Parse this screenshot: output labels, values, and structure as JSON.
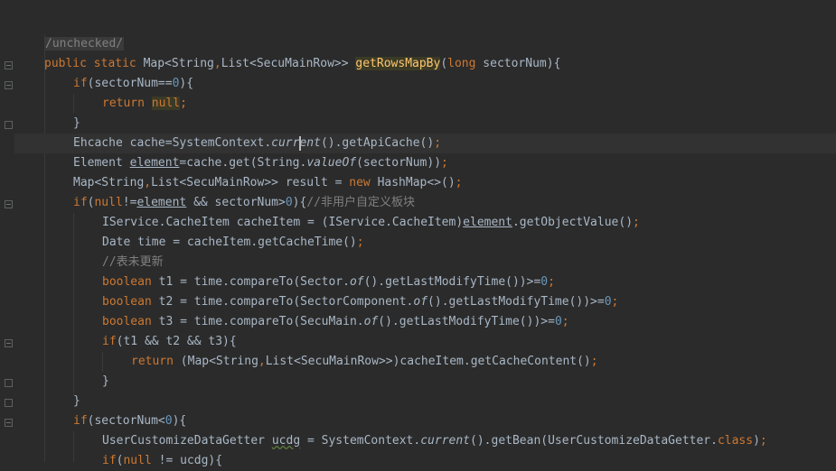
{
  "editor": {
    "lines": [
      {
        "tokens": [
          {
            "t": "/unchecked/",
            "c": "anno"
          }
        ]
      },
      {
        "tokens": [
          {
            "t": "public static ",
            "c": "kw"
          },
          {
            "t": "Map<String"
          },
          {
            "t": ",",
            "c": "kw"
          },
          {
            "t": "List<SecuMainRow>> "
          },
          {
            "t": "getRowsMapBy",
            "c": "fn-decl"
          },
          {
            "t": "("
          },
          {
            "t": "long ",
            "c": "kw"
          },
          {
            "t": "sectorNum){"
          }
        ]
      },
      {
        "tokens": [
          {
            "t": "if",
            "c": "kw"
          },
          {
            "t": "(sectorNum=="
          },
          {
            "t": "0",
            "c": "num"
          },
          {
            "t": "){"
          }
        ]
      },
      {
        "tokens": [
          {
            "t": "return ",
            "c": "kw"
          },
          {
            "t": "null",
            "c": "kw hl"
          },
          {
            "t": ";",
            "c": "kw"
          }
        ]
      },
      {
        "tokens": [
          {
            "t": "}"
          }
        ]
      },
      {
        "tokens": [
          {
            "t": "Ehcache cache=SystemContext."
          },
          {
            "t": "current",
            "c": "it"
          },
          {
            "t": "().getApiCache()"
          },
          {
            "t": ";",
            "c": "kw"
          }
        ]
      },
      {
        "tokens": [
          {
            "t": "Element "
          },
          {
            "t": "element",
            "c": "u"
          },
          {
            "t": "=cache.get(String."
          },
          {
            "t": "valueOf",
            "c": "it"
          },
          {
            "t": "(sectorNum))"
          },
          {
            "t": ";",
            "c": "kw"
          }
        ]
      },
      {
        "tokens": [
          {
            "t": "Map<String"
          },
          {
            "t": ",",
            "c": "kw"
          },
          {
            "t": "List<SecuMainRow>> result = "
          },
          {
            "t": "new ",
            "c": "kw"
          },
          {
            "t": "HashMap<>()"
          },
          {
            "t": ";",
            "c": "kw"
          }
        ]
      },
      {
        "tokens": [
          {
            "t": "if",
            "c": "kw"
          },
          {
            "t": "("
          },
          {
            "t": "null",
            "c": "kw"
          },
          {
            "t": "!="
          },
          {
            "t": "element",
            "c": "u"
          },
          {
            "t": " && sectorNum>"
          },
          {
            "t": "0",
            "c": "num"
          },
          {
            "t": "){"
          },
          {
            "t": "//非用户自定义板块",
            "c": "cm"
          }
        ]
      },
      {
        "tokens": [
          {
            "t": "IService.CacheItem cacheItem = (IService.CacheItem)"
          },
          {
            "t": "element",
            "c": "u"
          },
          {
            "t": ".getObjectValue()"
          },
          {
            "t": ";",
            "c": "kw"
          }
        ]
      },
      {
        "tokens": [
          {
            "t": "Date time = cacheItem.getCacheTime()"
          },
          {
            "t": ";",
            "c": "kw"
          }
        ]
      },
      {
        "tokens": [
          {
            "t": "//表未更新",
            "c": "cm"
          }
        ]
      },
      {
        "tokens": [
          {
            "t": "boolean ",
            "c": "kw"
          },
          {
            "t": "t1 = time.compareTo(Sector."
          },
          {
            "t": "of",
            "c": "it"
          },
          {
            "t": "().getLastModifyTime())>="
          },
          {
            "t": "0",
            "c": "num"
          },
          {
            "t": ";",
            "c": "kw"
          }
        ]
      },
      {
        "tokens": [
          {
            "t": "boolean ",
            "c": "kw"
          },
          {
            "t": "t2 = time.compareTo(SectorComponent."
          },
          {
            "t": "of",
            "c": "it"
          },
          {
            "t": "().getLastModifyTime())>="
          },
          {
            "t": "0",
            "c": "num"
          },
          {
            "t": ";",
            "c": "kw"
          }
        ]
      },
      {
        "tokens": [
          {
            "t": "boolean ",
            "c": "kw"
          },
          {
            "t": "t3 = time.compareTo(SecuMain."
          },
          {
            "t": "of",
            "c": "it"
          },
          {
            "t": "().getLastModifyTime())>="
          },
          {
            "t": "0",
            "c": "num"
          },
          {
            "t": ";",
            "c": "kw"
          }
        ]
      },
      {
        "tokens": [
          {
            "t": "if",
            "c": "kw"
          },
          {
            "t": "(t1 && t2 && t3){"
          }
        ]
      },
      {
        "tokens": [
          {
            "t": "return ",
            "c": "kw"
          },
          {
            "t": "(Map<String"
          },
          {
            "t": ",",
            "c": "kw"
          },
          {
            "t": "List<SecuMainRow>>)cacheItem.getCacheContent()"
          },
          {
            "t": ";",
            "c": "kw"
          }
        ]
      },
      {
        "tokens": [
          {
            "t": "}"
          }
        ]
      },
      {
        "tokens": [
          {
            "t": "}"
          }
        ]
      },
      {
        "tokens": [
          {
            "t": "if",
            "c": "kw"
          },
          {
            "t": "(sectorNum<"
          },
          {
            "t": "0",
            "c": "num"
          },
          {
            "t": "){"
          }
        ]
      },
      {
        "tokens": [
          {
            "t": "UserCustomizeDataGetter "
          },
          {
            "t": "ucdg",
            "c": "warn"
          },
          {
            "t": " = SystemContext."
          },
          {
            "t": "current",
            "c": "it"
          },
          {
            "t": "().getBean(UserCustomizeDataGetter."
          },
          {
            "t": "class",
            "c": "kw"
          },
          {
            "t": ")"
          },
          {
            "t": ";",
            "c": "kw"
          }
        ]
      },
      {
        "tokens": [
          {
            "t": "if",
            "c": "kw"
          },
          {
            "t": "("
          },
          {
            "t": "null",
            "c": "kw"
          },
          {
            "t": " != ucdg){"
          }
        ]
      }
    ]
  }
}
